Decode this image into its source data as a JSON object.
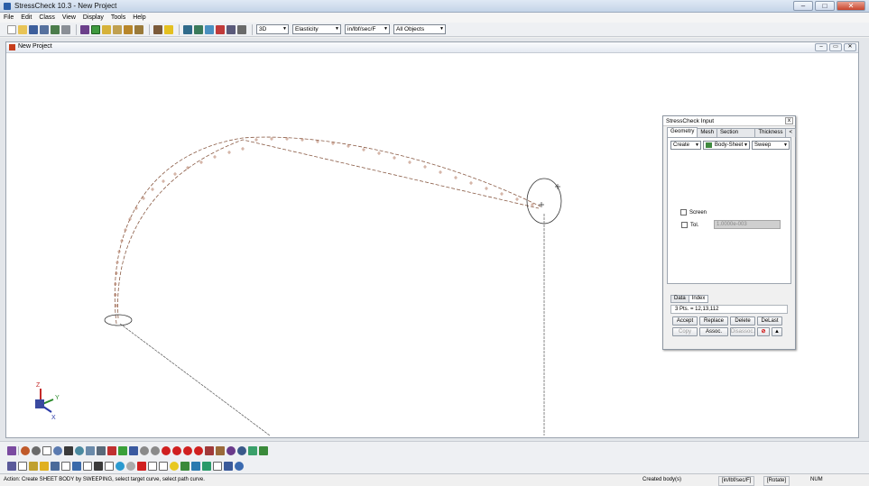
{
  "window": {
    "title": "StressCheck 10.3 - New Project"
  },
  "menu": [
    "File",
    "Edit",
    "Class",
    "View",
    "Display",
    "Tools",
    "Help"
  ],
  "toolbar": {
    "view_mode": "3D",
    "analysis": "Elasticity",
    "units": "in/lbf/sec/F",
    "filter": "All Objects"
  },
  "child_window": {
    "title": "New Project"
  },
  "axes": {
    "z": "Z",
    "y": "Y",
    "x": "X"
  },
  "panel": {
    "title": "StressCheck Input",
    "close": "x",
    "tabs": [
      "Geometry",
      "Mesh",
      "Section Prop.",
      "Thickness"
    ],
    "tab_scroll": "<",
    "method": "Create",
    "object": "Body-Sheet",
    "technique": "Sweep",
    "screen_label": "Screen",
    "tol_label": "Tol.",
    "tol_value": "1.0000e-003",
    "subtabs": [
      "Data",
      "Index"
    ],
    "info": "3 Pts. = 12,13,112",
    "buttons_row1": [
      "Accept",
      "Replace",
      "Delete",
      "DeLast"
    ],
    "buttons_row2": [
      "Copy",
      "Assoc.",
      "Disassoc."
    ]
  },
  "status": {
    "action": "Action: Create SHEET BODY by SWEEPING, select target curve, select path curve.",
    "message": "Created body(s)",
    "units": "[in/lbf/sec/F]",
    "mode": "[Rotate]",
    "num": "NUM"
  },
  "colors": {
    "curve": "#a8674a",
    "dashed": "#555555",
    "accent": "#2b5fa8"
  }
}
